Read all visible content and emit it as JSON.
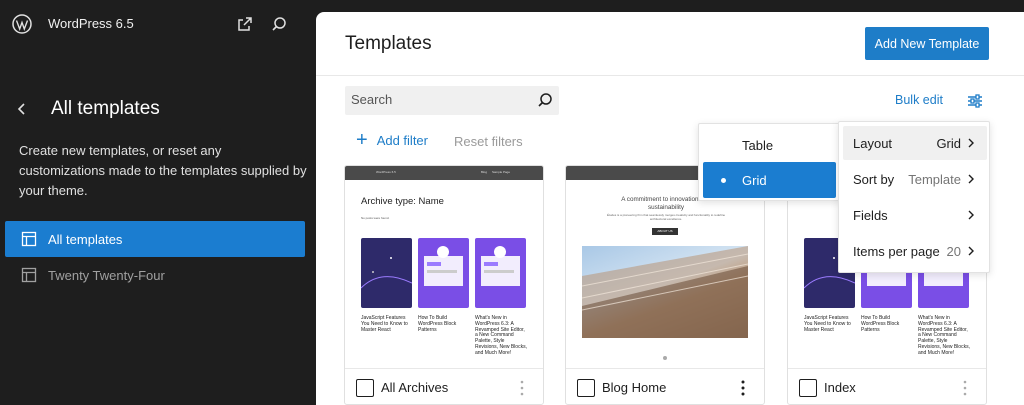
{
  "site": {
    "name": "WordPress 6.5"
  },
  "sidebar": {
    "title": "All templates",
    "description": "Create new templates, or reset any customizations made to the templates supplied by your theme.",
    "items": [
      {
        "label": "All templates",
        "active": true
      },
      {
        "label": "Twenty Twenty-Four",
        "active": false
      }
    ]
  },
  "header": {
    "title": "Templates",
    "add_new_label": "Add New Template"
  },
  "toolbar": {
    "search_placeholder": "Search",
    "bulk_edit_label": "Bulk edit",
    "add_filter_label": "Add filter",
    "reset_filters_label": "Reset filters"
  },
  "layout_menu": {
    "options": [
      {
        "label": "Table",
        "selected": false
      },
      {
        "label": "Grid",
        "selected": true
      }
    ]
  },
  "view_menu": {
    "rows": [
      {
        "label": "Layout",
        "value": "Grid"
      },
      {
        "label": "Sort by",
        "value": "Template"
      },
      {
        "label": "Fields",
        "value": ""
      },
      {
        "label": "Items per page",
        "value": "20"
      }
    ]
  },
  "cards": [
    {
      "name": "All Archives",
      "preview": {
        "site": "WordPress 6.5",
        "nav": [
          "Blog",
          "Sample Page"
        ],
        "title": "Archive type: Name",
        "subtitle": "No posts were found.",
        "posts": [
          "JavaScript Features You Need to Know to Master React",
          "How To Build WordPress Block Patterns",
          "What's New in WordPress 6.3: A Revamped Site Editor, a New Command Palette, Style Revisions, New Blocks, and Much More!"
        ]
      }
    },
    {
      "name": "Blog Home",
      "preview": {
        "hero": "A commitment to innovation and sustainability",
        "hero_sub": "Études is a pioneering firm that seamlessly merges creativity and functionality to redefine architectural excellence.",
        "button": "ABOUT US"
      }
    },
    {
      "name": "Index",
      "preview": {
        "site_label": "Posts",
        "posts": [
          "JavaScript Features You Need to Know to Master React",
          "How To Build WordPress Block Patterns",
          "What's New in WordPress 6.3: A Revamped Site Editor, a New Command Palette, Style Revisions, New Blocks, and Much More!"
        ]
      }
    }
  ],
  "colors": {
    "accent": "#1e7dc8",
    "sidebar_bg": "#1e1e1e",
    "selected_bg": "#1b7dd0"
  }
}
